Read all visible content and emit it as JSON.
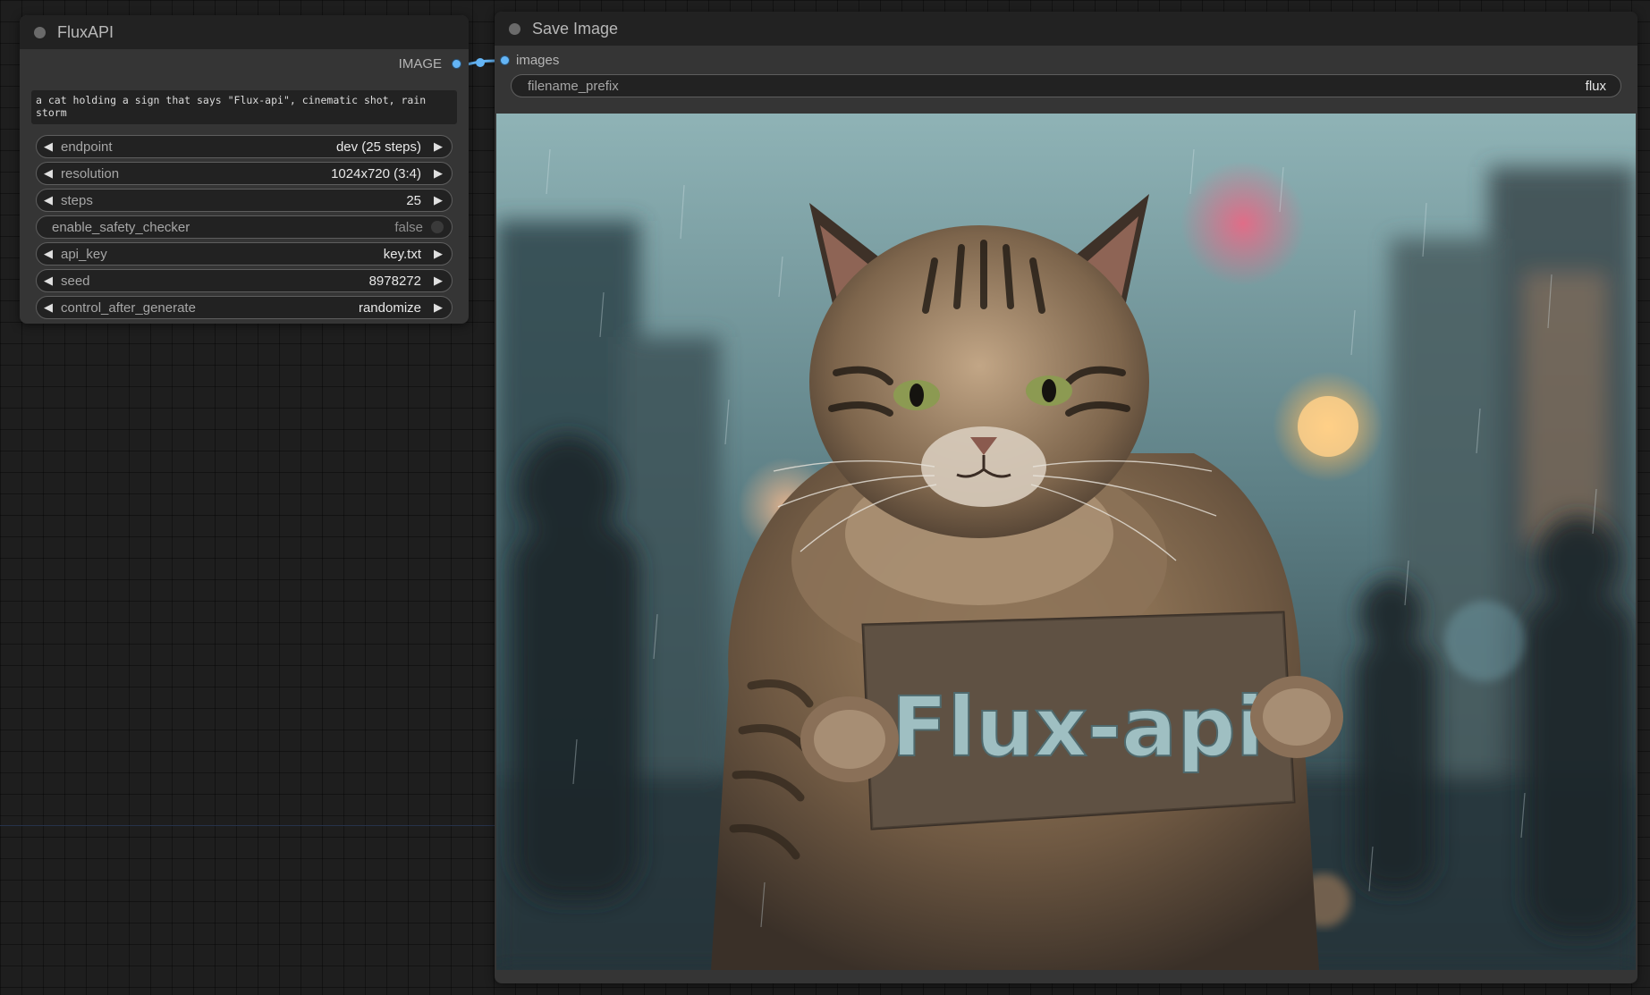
{
  "flux_node": {
    "title": "FluxAPI",
    "output_label": "IMAGE",
    "prompt_text": "a cat holding a sign that says \"Flux-api\", cinematic shot, rain\nstorm",
    "widgets": {
      "endpoint": {
        "label": "endpoint",
        "value": "dev (25 steps)"
      },
      "resolution": {
        "label": "resolution",
        "value": "1024x720 (3:4)"
      },
      "steps": {
        "label": "steps",
        "value": "25"
      },
      "safety": {
        "label": "enable_safety_checker",
        "value": "false"
      },
      "api_key": {
        "label": "api_key",
        "value": "key.txt"
      },
      "seed": {
        "label": "seed",
        "value": "8978272"
      },
      "control": {
        "label": "control_after_generate",
        "value": "randomize"
      }
    }
  },
  "save_node": {
    "title": "Save Image",
    "input_label": "images",
    "filename_prefix": {
      "label": "filename_prefix",
      "value": "flux"
    },
    "preview": {
      "sign_text": "Flux-api",
      "description": "generated image preview"
    }
  },
  "colors": {
    "canvas_bg": "#1e1e1e",
    "node_body": "#353535",
    "node_header": "#222222",
    "widget_bg": "#222222",
    "socket_image": "#64b5f6",
    "wire": "#64b5f6"
  },
  "icons": {
    "decrement": "left-triangle",
    "increment": "right-triangle",
    "collapse": "dot"
  }
}
